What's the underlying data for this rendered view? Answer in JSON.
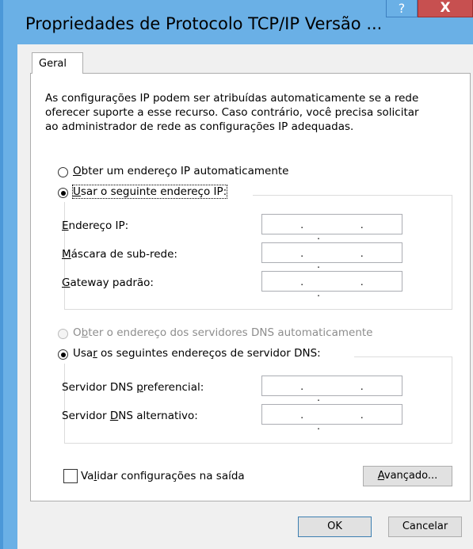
{
  "window": {
    "title": "Propriedades de Protocolo TCP/IP Versão ...",
    "help_glyph": "?",
    "close_glyph": "X"
  },
  "tabs": [
    {
      "label": "Geral",
      "selected": true
    }
  ],
  "description": "As configurações IP podem ser atribuídas automaticamente se a rede\noferecer suporte a esse recurso. Caso contrário, você precisa solicitar\nao administrador de rede as configurações IP adequadas.",
  "ip_mode": {
    "auto": {
      "label_key": "O",
      "label_rest": "bter um endereço IP automaticamente",
      "selected": false
    },
    "manual": {
      "label_key": "U",
      "label_rest": "sar o seguinte endereço IP:",
      "selected": true
    }
  },
  "ip_fields": [
    {
      "label_pre": "",
      "label_key": "E",
      "label_rest": "ndereço IP:",
      "value": ". . ."
    },
    {
      "label_pre": "",
      "label_key": "M",
      "label_rest": "áscara de sub-rede:",
      "value": ". . ."
    },
    {
      "label_pre": "",
      "label_key": "G",
      "label_rest": "ateway padrão:",
      "value": ". . ."
    }
  ],
  "dns_mode": {
    "auto": {
      "label_pre": "O",
      "label_key": "b",
      "label_rest": "ter o endereço dos servidores DNS automaticamente",
      "selected": false,
      "disabled": true
    },
    "manual": {
      "label_pre": "Usa",
      "label_key": "r",
      "label_rest": " os seguintes endereços de servidor DNS:",
      "selected": true
    }
  },
  "dns_fields": [
    {
      "label_pre": "Servidor DNS ",
      "label_key": "p",
      "label_rest": "referencial:",
      "value": ". . ."
    },
    {
      "label_pre": "Servidor ",
      "label_key": "D",
      "label_rest": "NS alternativo:",
      "value": ". . ."
    }
  ],
  "validate": {
    "label_pre": "Va",
    "label_key": "l",
    "label_rest": "idar configurações na saída",
    "checked": false
  },
  "buttons": {
    "advanced": {
      "label_key": "A",
      "label_rest": "vançado..."
    },
    "ok": "OK",
    "cancel": "Cancelar"
  },
  "colors": {
    "titlebar": "#6ab0e6",
    "close_button": "#c75050",
    "client_bg": "#f0f0f0"
  }
}
